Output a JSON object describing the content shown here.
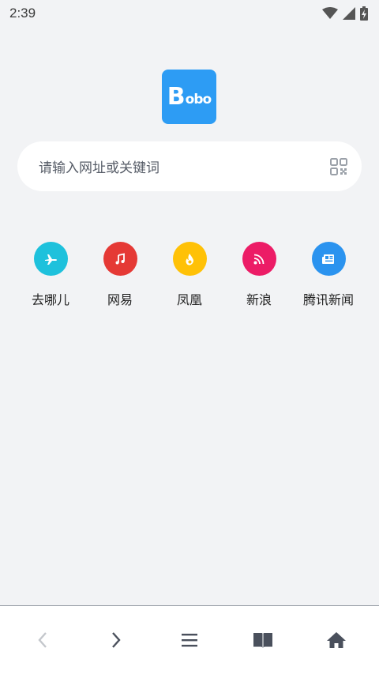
{
  "status_bar": {
    "time": "2:39"
  },
  "logo": {
    "big_letter": "B",
    "rest": "obo"
  },
  "search": {
    "placeholder": "请输入网址或关键词"
  },
  "shortcuts": [
    {
      "label": "去哪儿",
      "color": "#1ec1dc",
      "icon": "airplane-icon"
    },
    {
      "label": "网易",
      "color": "#e53935",
      "icon": "music-note-icon"
    },
    {
      "label": "凤凰",
      "color": "#ffc107",
      "icon": "flame-icon"
    },
    {
      "label": "新浪",
      "color": "#ec1c66",
      "icon": "rss-icon"
    },
    {
      "label": "腾讯新闻",
      "color": "#2b93ef",
      "icon": "newspaper-icon"
    }
  ],
  "bottom_nav": [
    {
      "name": "back",
      "icon": "chevron-left-icon",
      "enabled": false
    },
    {
      "name": "forward",
      "icon": "chevron-right-icon",
      "enabled": true
    },
    {
      "name": "menu",
      "icon": "menu-icon",
      "enabled": true
    },
    {
      "name": "bookmarks",
      "icon": "book-icon",
      "enabled": true
    },
    {
      "name": "home",
      "icon": "home-icon",
      "enabled": true
    }
  ]
}
